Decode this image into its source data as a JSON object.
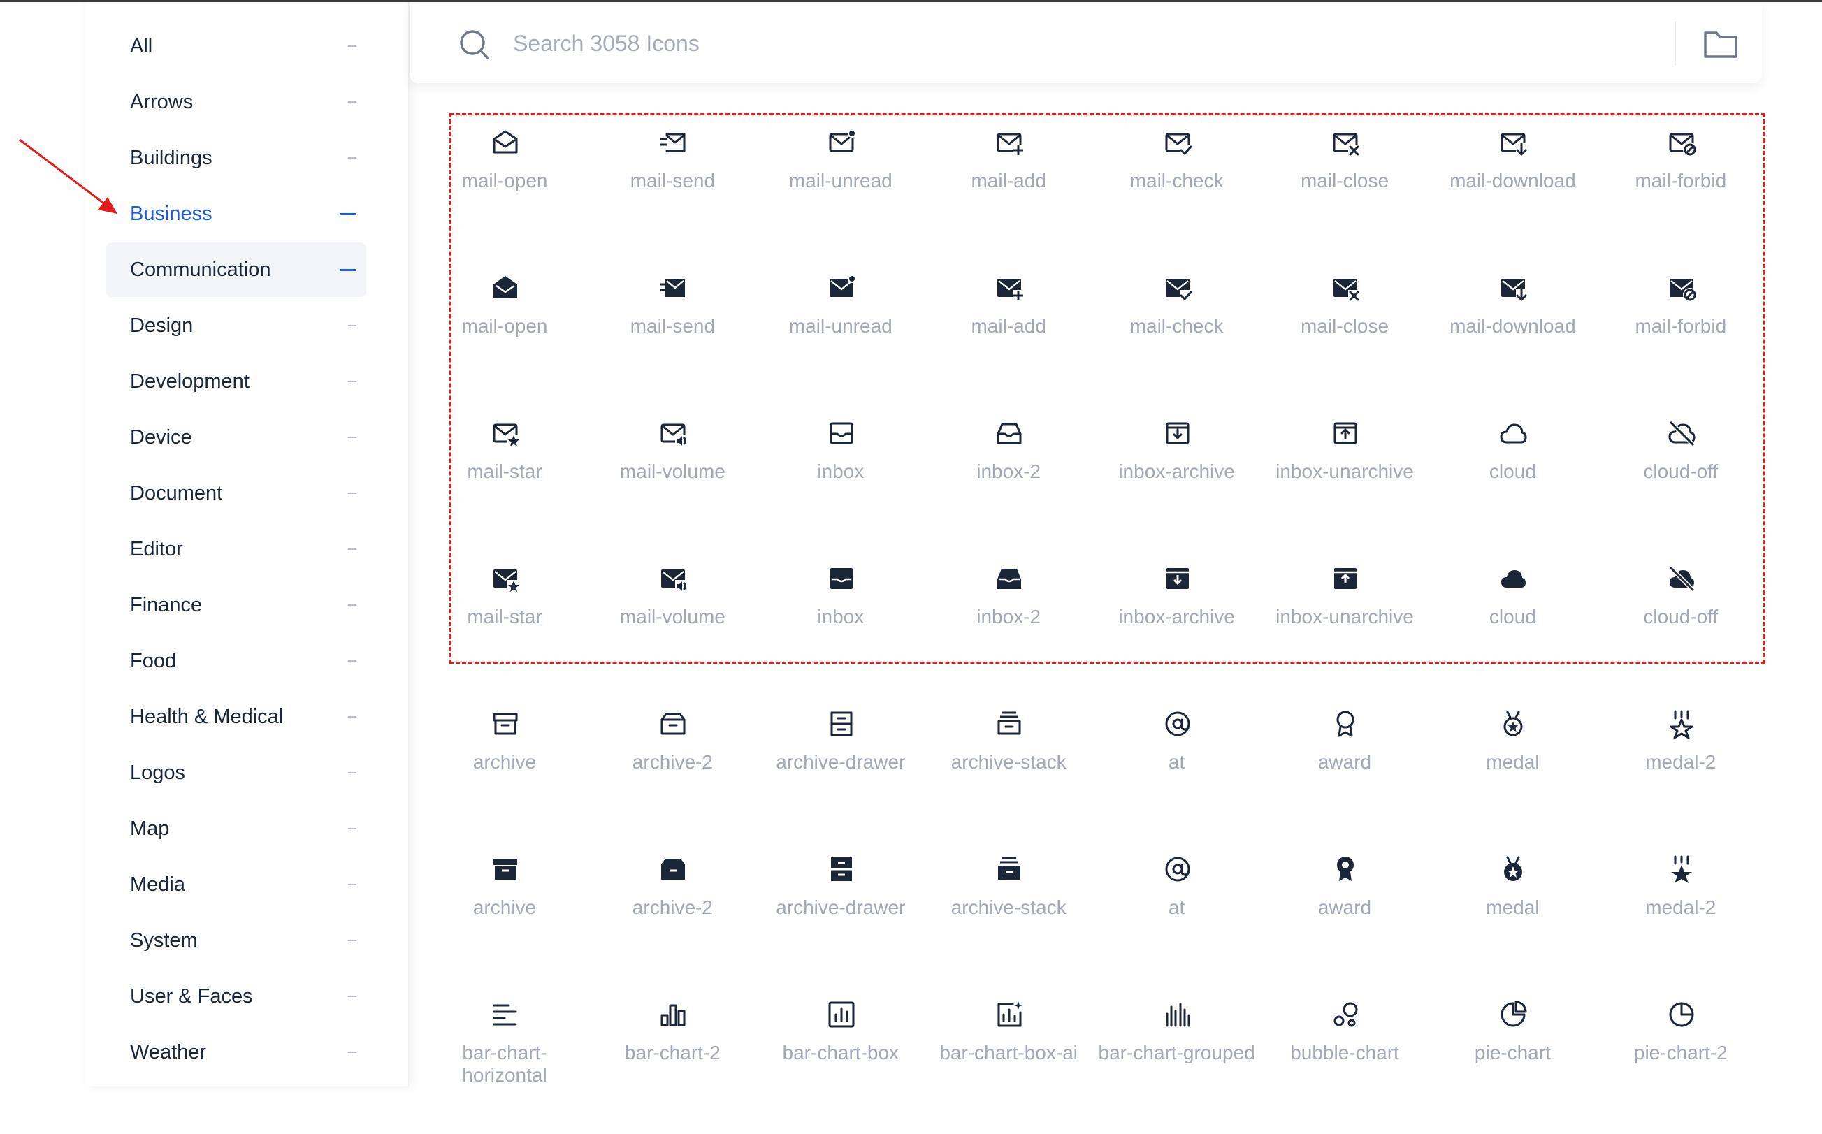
{
  "search": {
    "placeholder": "Search 3058 Icons"
  },
  "categories": [
    {
      "label": "All",
      "state": "normal"
    },
    {
      "label": "Arrows",
      "state": "normal"
    },
    {
      "label": "Buildings",
      "state": "normal"
    },
    {
      "label": "Business",
      "state": "active"
    },
    {
      "label": "Communication",
      "state": "open"
    },
    {
      "label": "Design",
      "state": "normal"
    },
    {
      "label": "Development",
      "state": "normal"
    },
    {
      "label": "Device",
      "state": "normal"
    },
    {
      "label": "Document",
      "state": "normal"
    },
    {
      "label": "Editor",
      "state": "normal"
    },
    {
      "label": "Finance",
      "state": "normal"
    },
    {
      "label": "Food",
      "state": "normal"
    },
    {
      "label": "Health & Medical",
      "state": "normal"
    },
    {
      "label": "Logos",
      "state": "normal"
    },
    {
      "label": "Map",
      "state": "normal"
    },
    {
      "label": "Media",
      "state": "normal"
    },
    {
      "label": "System",
      "state": "normal"
    },
    {
      "label": "User & Faces",
      "state": "normal"
    },
    {
      "label": "Weather",
      "state": "normal"
    }
  ],
  "icon_rows": [
    [
      {
        "name": "mail-open",
        "icon": "mail-open-icon",
        "style": "line"
      },
      {
        "name": "mail-send",
        "icon": "mail-send-icon",
        "style": "line"
      },
      {
        "name": "mail-unread",
        "icon": "mail-unread-icon",
        "style": "line"
      },
      {
        "name": "mail-add",
        "icon": "mail-add-icon",
        "style": "line"
      },
      {
        "name": "mail-check",
        "icon": "mail-check-icon",
        "style": "line"
      },
      {
        "name": "mail-close",
        "icon": "mail-close-icon",
        "style": "line"
      },
      {
        "name": "mail-download",
        "icon": "mail-download-icon",
        "style": "line"
      },
      {
        "name": "mail-forbid",
        "icon": "mail-forbid-icon",
        "style": "line"
      }
    ],
    [
      {
        "name": "mail-open",
        "icon": "mail-open-icon",
        "style": "fill"
      },
      {
        "name": "mail-send",
        "icon": "mail-send-icon",
        "style": "fill"
      },
      {
        "name": "mail-unread",
        "icon": "mail-unread-icon",
        "style": "fill"
      },
      {
        "name": "mail-add",
        "icon": "mail-add-icon",
        "style": "fill"
      },
      {
        "name": "mail-check",
        "icon": "mail-check-icon",
        "style": "fill"
      },
      {
        "name": "mail-close",
        "icon": "mail-close-icon",
        "style": "fill"
      },
      {
        "name": "mail-download",
        "icon": "mail-download-icon",
        "style": "fill"
      },
      {
        "name": "mail-forbid",
        "icon": "mail-forbid-icon",
        "style": "fill"
      }
    ],
    [
      {
        "name": "mail-star",
        "icon": "mail-star-icon",
        "style": "line"
      },
      {
        "name": "mail-volume",
        "icon": "mail-volume-icon",
        "style": "line"
      },
      {
        "name": "inbox",
        "icon": "inbox-icon",
        "style": "line"
      },
      {
        "name": "inbox-2",
        "icon": "inbox-2-icon",
        "style": "line"
      },
      {
        "name": "inbox-archive",
        "icon": "inbox-archive-icon",
        "style": "line"
      },
      {
        "name": "inbox-unarchive",
        "icon": "inbox-unarchive-icon",
        "style": "line"
      },
      {
        "name": "cloud",
        "icon": "cloud-icon",
        "style": "line"
      },
      {
        "name": "cloud-off",
        "icon": "cloud-off-icon",
        "style": "line"
      }
    ],
    [
      {
        "name": "mail-star",
        "icon": "mail-star-icon",
        "style": "fill"
      },
      {
        "name": "mail-volume",
        "icon": "mail-volume-icon",
        "style": "fill"
      },
      {
        "name": "inbox",
        "icon": "inbox-icon",
        "style": "fill"
      },
      {
        "name": "inbox-2",
        "icon": "inbox-2-icon",
        "style": "fill"
      },
      {
        "name": "inbox-archive",
        "icon": "inbox-archive-icon",
        "style": "fill"
      },
      {
        "name": "inbox-unarchive",
        "icon": "inbox-unarchive-icon",
        "style": "fill"
      },
      {
        "name": "cloud",
        "icon": "cloud-icon",
        "style": "fill"
      },
      {
        "name": "cloud-off",
        "icon": "cloud-off-icon",
        "style": "fill"
      }
    ],
    [
      {
        "name": "archive",
        "icon": "archive-icon",
        "style": "line"
      },
      {
        "name": "archive-2",
        "icon": "archive-2-icon",
        "style": "line"
      },
      {
        "name": "archive-drawer",
        "icon": "archive-drawer-icon",
        "style": "line"
      },
      {
        "name": "archive-stack",
        "icon": "archive-stack-icon",
        "style": "line"
      },
      {
        "name": "at",
        "icon": "at-icon",
        "style": "line"
      },
      {
        "name": "award",
        "icon": "award-icon",
        "style": "line"
      },
      {
        "name": "medal",
        "icon": "medal-icon",
        "style": "line"
      },
      {
        "name": "medal-2",
        "icon": "medal-2-icon",
        "style": "line"
      }
    ],
    [
      {
        "name": "archive",
        "icon": "archive-icon",
        "style": "fill"
      },
      {
        "name": "archive-2",
        "icon": "archive-2-icon",
        "style": "fill"
      },
      {
        "name": "archive-drawer",
        "icon": "archive-drawer-icon",
        "style": "fill"
      },
      {
        "name": "archive-stack",
        "icon": "archive-stack-icon",
        "style": "fill"
      },
      {
        "name": "at",
        "icon": "at-icon",
        "style": "fill"
      },
      {
        "name": "award",
        "icon": "award-icon",
        "style": "fill"
      },
      {
        "name": "medal",
        "icon": "medal-icon",
        "style": "fill"
      },
      {
        "name": "medal-2",
        "icon": "medal-2-icon",
        "style": "fill"
      }
    ],
    [
      {
        "name": "bar-chart-horizontal",
        "icon": "bar-chart-horizontal-icon",
        "style": "line"
      },
      {
        "name": "bar-chart-2",
        "icon": "bar-chart-2-icon",
        "style": "line"
      },
      {
        "name": "bar-chart-box",
        "icon": "bar-chart-box-icon",
        "style": "line"
      },
      {
        "name": "bar-chart-box-ai",
        "icon": "bar-chart-box-ai-icon",
        "style": "line"
      },
      {
        "name": "bar-chart-grouped",
        "icon": "bar-chart-grouped-icon",
        "style": "line"
      },
      {
        "name": "bubble-chart",
        "icon": "bubble-chart-icon",
        "style": "line"
      },
      {
        "name": "pie-chart",
        "icon": "pie-chart-icon",
        "style": "line"
      },
      {
        "name": "pie-chart-2",
        "icon": "pie-chart-2-icon",
        "style": "line"
      }
    ]
  ],
  "colors": {
    "accent": "#1d5ce0",
    "icon": "#1b2638",
    "label": "#a2a9b5",
    "highlight": "#e31b1b",
    "arrow": "#e31b1b"
  }
}
